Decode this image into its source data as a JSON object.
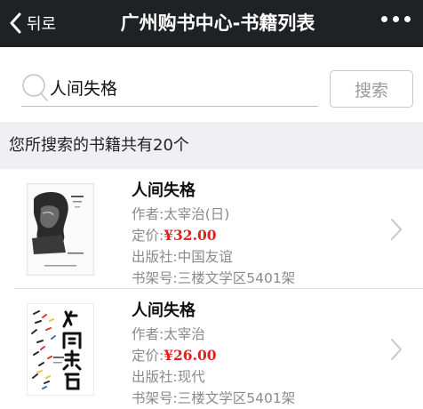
{
  "header": {
    "back_label": "뒤로",
    "title": "广州购书中心-书籍列表"
  },
  "search": {
    "value": "人间失格",
    "button_label": "搜索"
  },
  "result": {
    "summary": "您所搜索的书籍共有20个"
  },
  "books": [
    {
      "name": "人间失格",
      "author_label": "作者:",
      "author": "太宰治(日)",
      "price_label": "定价:",
      "price": "¥32.00",
      "publisher_label": "出版社:",
      "publisher": "中国友谊",
      "shelf_label": "书架号:",
      "shelf": "三楼文学区5401架"
    },
    {
      "name": "人间失格",
      "author_label": "作者:",
      "author": "太宰治",
      "price_label": "定价:",
      "price": "¥26.00",
      "publisher_label": "出版社:",
      "publisher": "现代",
      "shelf_label": "书架号:",
      "shelf": "三楼文学区5401架"
    }
  ],
  "colors": {
    "topbar": "#202124",
    "price": "#e02020",
    "section_bg": "#efeff4"
  }
}
